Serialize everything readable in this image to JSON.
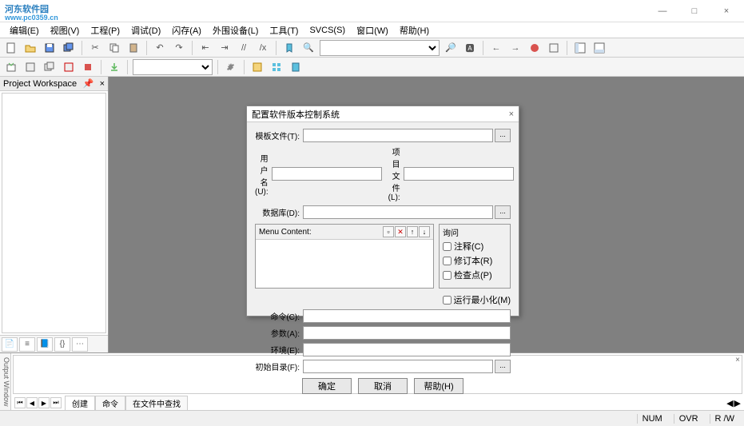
{
  "watermark": {
    "line1": "河东软件园",
    "sub": "www.pc0359.cn"
  },
  "window": {
    "minimize": "—",
    "maximize": "□",
    "close": "×"
  },
  "menu": [
    "编辑(E)",
    "视图(V)",
    "工程(P)",
    "调试(D)",
    "闪存(A)",
    "外围设备(L)",
    "工具(T)",
    "SVCS(S)",
    "窗口(W)",
    "帮助(H)"
  ],
  "toolbar1": {
    "find_combo": ""
  },
  "sidebar": {
    "title": "Project Workspace",
    "close": "×"
  },
  "dialog": {
    "title": "配置软件版本控制系统",
    "close": "×",
    "fields": {
      "template": "模板文件(T):",
      "username": "用户名(U):",
      "projfile": "项目文件(L):",
      "database": "数据库(D):",
      "menu_content": "Menu Content:",
      "command": "命令(C):",
      "params": "参数(A):",
      "env": "环境(E):",
      "initdir": "初始目录(F):"
    },
    "dots": "...",
    "query": {
      "title": "询问",
      "comment": "注释(C)",
      "revision": "修订本(R)",
      "checkpoint": "检查点(P)"
    },
    "minimize": "运行最小化(M)",
    "buttons": {
      "ok": "确定",
      "cancel": "取消",
      "help": "帮助(H)"
    },
    "values": {
      "template": "",
      "username": "",
      "projfile": "",
      "database": "",
      "command": "",
      "params": "",
      "env": "",
      "initdir": ""
    }
  },
  "output": {
    "label": "Output Window",
    "close": "×",
    "tabs": [
      "创建",
      "命令",
      "在文件中查找"
    ]
  },
  "status": {
    "num": "NUM",
    "ovr": "OVR",
    "rw": "R /W"
  }
}
